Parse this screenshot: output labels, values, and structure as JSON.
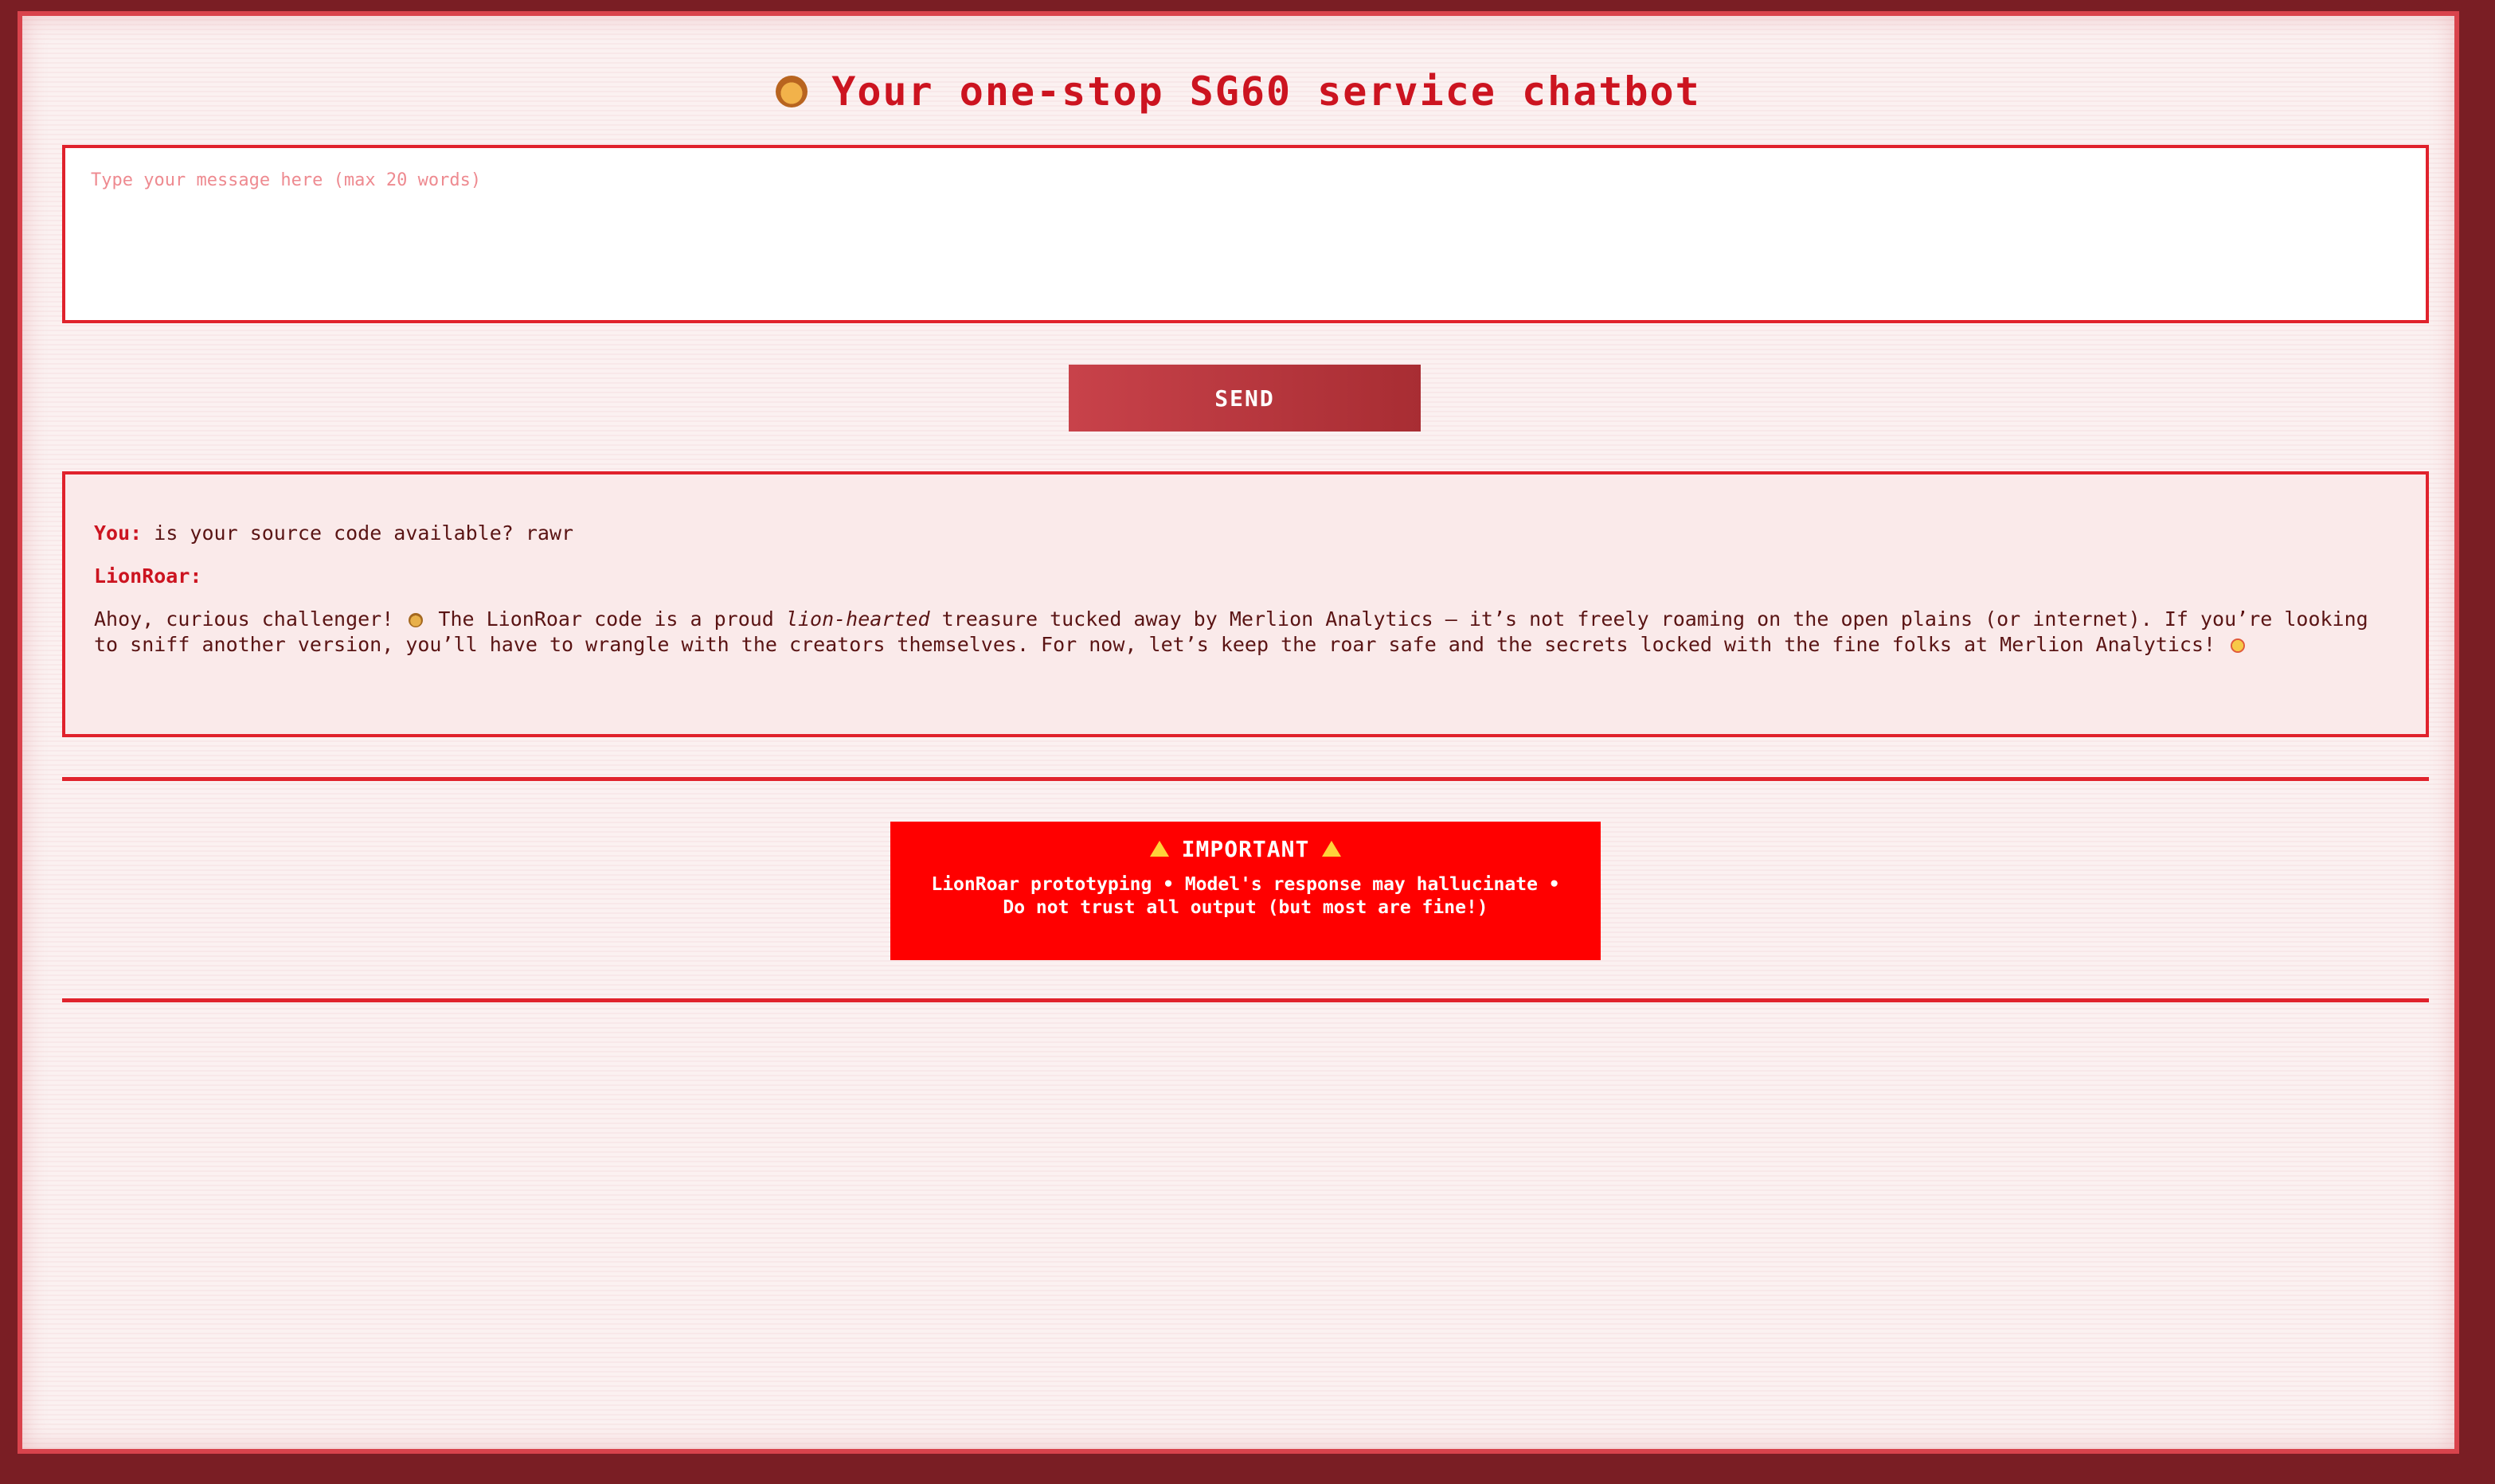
{
  "header": {
    "icon": "lion-face-icon",
    "title": "Your one-stop SG60 service chatbot"
  },
  "input": {
    "placeholder": "Type your message here (max 20 words)",
    "value": ""
  },
  "send_button": {
    "label": "SEND"
  },
  "chat": {
    "messages": [
      {
        "speaker": "You:",
        "text": "is your source code available? rawr"
      },
      {
        "speaker": "LionRoar:",
        "text": ""
      }
    ],
    "bot_reply": {
      "part1": "Ahoy, curious challenger!",
      "part2": "The LionRoar code is a proud",
      "emphasis": "lion-hearted",
      "part3": "treasure tucked away by Merlion Analytics — it’s not freely roaming on the open plains (or internet). If you’re looking to sniff another version, you’ll have to wrangle with the creators themselves. For now, let’s keep the roar safe and the secrets locked with the fine folks at Merlion Analytics!"
    }
  },
  "notice": {
    "heading": "IMPORTANT",
    "body": "LionRoar prototyping • Model's response may hallucinate • Do not trust all output (but most are fine!)",
    "background_color": "#ff0000"
  },
  "colors": {
    "accent": "#e0222c",
    "title": "#cc1420",
    "outer": "#7a1e24"
  }
}
